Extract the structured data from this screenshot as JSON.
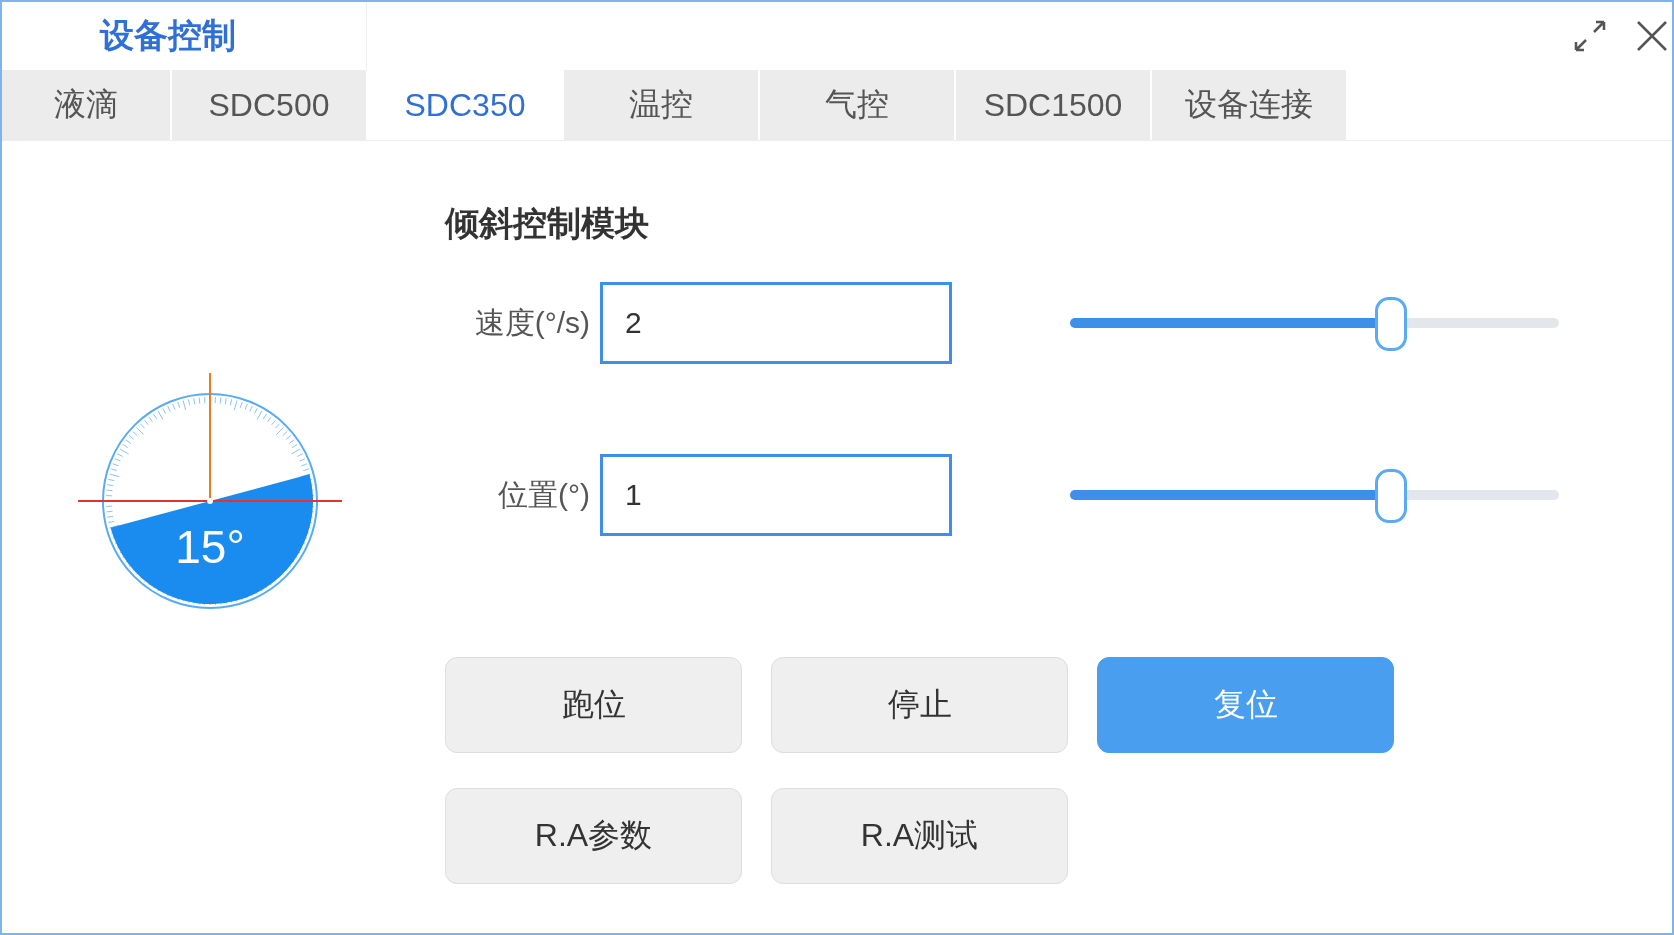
{
  "window": {
    "title": "设备控制"
  },
  "tabs": [
    {
      "label": "液滴",
      "selected": false
    },
    {
      "label": "SDC500",
      "selected": false
    },
    {
      "label": "SDC350",
      "selected": true
    },
    {
      "label": "温控",
      "selected": false
    },
    {
      "label": "气控",
      "selected": false
    },
    {
      "label": "SDC1500",
      "selected": false
    },
    {
      "label": "设备连接",
      "selected": false
    }
  ],
  "gauge": {
    "reading": "15°"
  },
  "section": {
    "title": "倾斜控制模块"
  },
  "fields": [
    {
      "label": "速度(°/s)",
      "value": "2",
      "level": 0.655
    },
    {
      "label": "位置(°)",
      "value": "1",
      "level": 0.655
    }
  ],
  "buttons": [
    {
      "label": "跑位",
      "primary": false
    },
    {
      "label": "停止",
      "primary": false
    },
    {
      "label": "复位",
      "primary": true
    },
    {
      "label": "R.A参数",
      "primary": false
    },
    {
      "label": "R.A测试",
      "primary": false
    }
  ]
}
